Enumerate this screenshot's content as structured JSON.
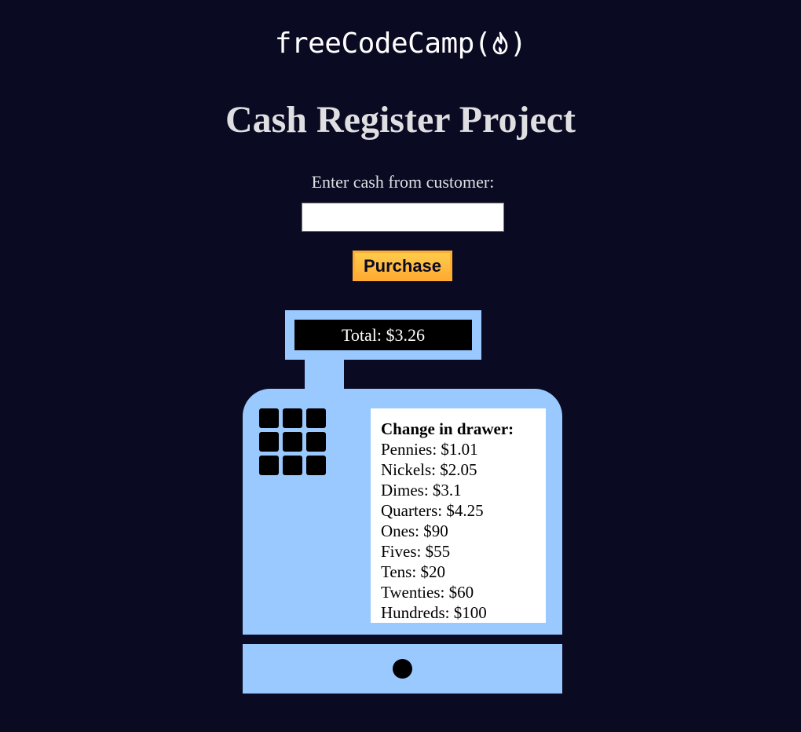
{
  "logo": {
    "text": "freeCodeCamp",
    "open_paren": "(",
    "close_paren": ")",
    "icon": "flame-icon"
  },
  "page": {
    "title": "Cash Register Project"
  },
  "form": {
    "cash_label": "Enter cash from customer:",
    "cash_value": "",
    "purchase_label": "Purchase"
  },
  "register": {
    "total_text": "Total: $3.26",
    "drawer_title": "Change in drawer:",
    "drawer_items": [
      "Pennies: $1.01",
      "Nickels: $2.05",
      "Dimes: $3.1",
      "Quarters: $4.25",
      "Ones: $90",
      "Fives: $55",
      "Tens: $20",
      "Twenties: $60",
      "Hundreds: $100"
    ]
  },
  "colors": {
    "background": "#0a0a23",
    "register_body": "#99c9ff",
    "button_gradient_top": "#fecc4c",
    "button_gradient_bottom": "#ffac33",
    "text_light": "#dfdfe2"
  }
}
